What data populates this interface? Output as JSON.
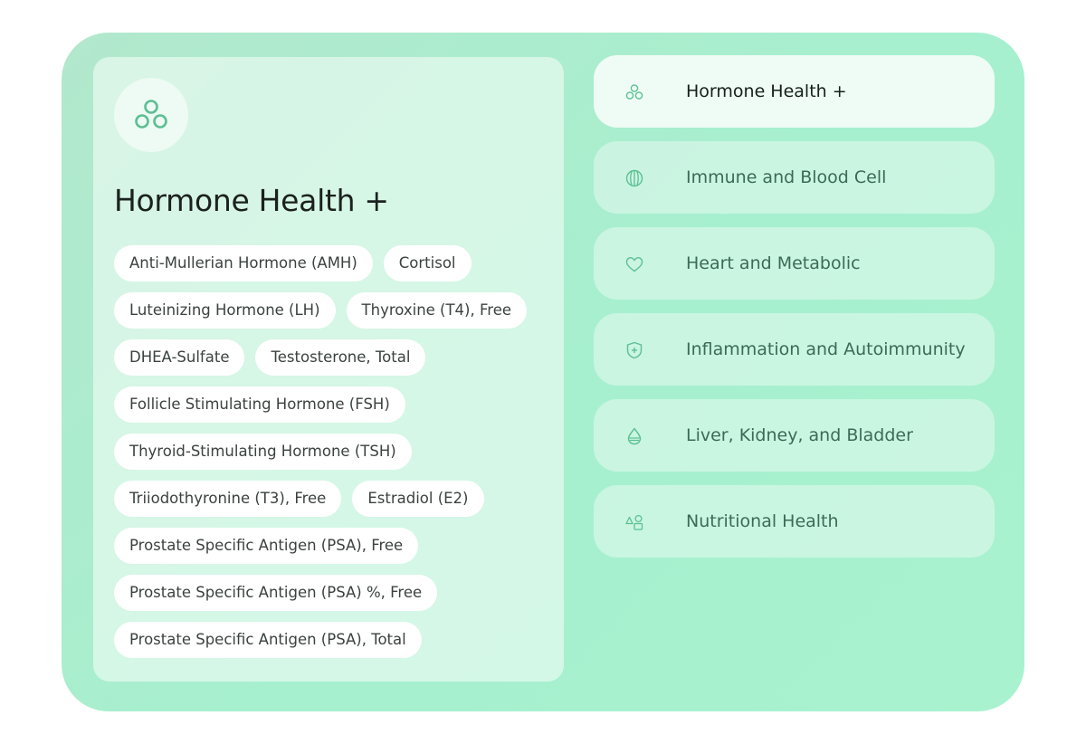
{
  "detail": {
    "title": "Hormone Health +",
    "icon": "three-circles-icon",
    "chip_rows": [
      [
        "Anti-Mullerian Hormone (AMH)",
        "Cortisol"
      ],
      [
        "Luteinizing Hormone (LH)",
        "Thyroxine (T4), Free"
      ],
      [
        "DHEA-Sulfate",
        "Testosterone, Total"
      ],
      [
        "Follicle Stimulating Hormone (FSH)"
      ],
      [
        "Thyroid-Stimulating Hormone (TSH)"
      ],
      [
        "Triiodothyronine (T3), Free",
        "Estradiol (E2)"
      ],
      [
        "Prostate Specific Antigen (PSA), Free"
      ],
      [
        "Prostate Specific Antigen (PSA) %, Free"
      ],
      [
        "Prostate Specific Antigen (PSA), Total"
      ]
    ]
  },
  "categories": [
    {
      "label": "Hormone Health +",
      "icon": "three-circles-icon",
      "active": true
    },
    {
      "label": "Immune and Blood Cell",
      "icon": "blood-cell-icon",
      "active": false
    },
    {
      "label": "Heart and Metabolic",
      "icon": "heart-icon",
      "active": false
    },
    {
      "label": "Inflammation and Autoimmunity",
      "icon": "shield-plus-icon",
      "active": false
    },
    {
      "label": "Liver, Kidney, and Bladder",
      "icon": "droplet-icon",
      "active": false
    },
    {
      "label": "Nutritional Health",
      "icon": "shapes-icon",
      "active": false
    }
  ],
  "colors": {
    "accent": "#5cbf93",
    "panel": "#a9f0cf",
    "chip_bg": "#ffffff"
  }
}
